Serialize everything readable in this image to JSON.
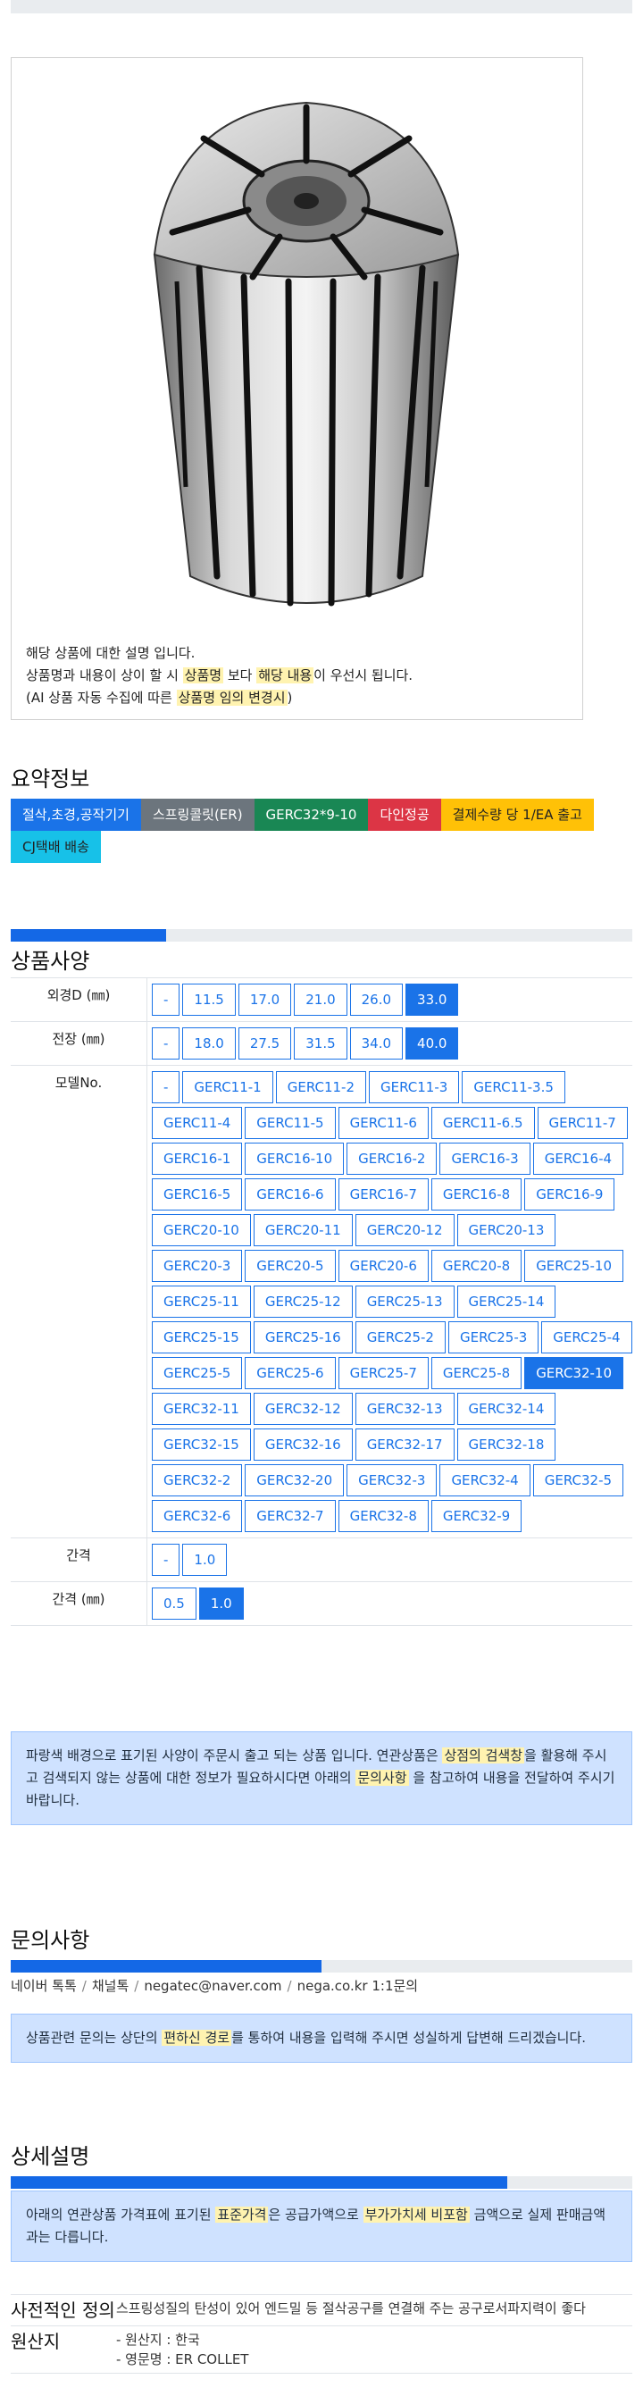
{
  "notice": {
    "line1": "해당 상품에 대한 설명 입니다.",
    "line2_pre": "상품명과 내용이 상이 할 시 ",
    "line2_hl1": "상품명",
    "line2_mid": " 보다 ",
    "line2_hl2": "해당 내용",
    "line2_post": "이 우선시 됩니다.",
    "line3_pre": "(AI 상품 자동 수집에 따른 ",
    "line3_hl": "상품명 임의 변경시",
    "line3_post": ")"
  },
  "summary": {
    "title": "요약정보",
    "badges": [
      "절삭,초경,공작기기",
      "스프링콜릿(ER)",
      "GERC32*9-10",
      "다인정공",
      "결제수량 당 1/EA 출고",
      "CJ택배 배송"
    ]
  },
  "spec": {
    "title": "상품사양",
    "rows": [
      {
        "label": "외경D (㎜)",
        "options": [
          "-",
          "11.5",
          "17.0",
          "21.0",
          "26.0",
          "33.0"
        ],
        "selected": "33.0"
      },
      {
        "label": "전장 (㎜)",
        "options": [
          "-",
          "18.0",
          "27.5",
          "31.5",
          "34.0",
          "40.0"
        ],
        "selected": "40.0"
      },
      {
        "label": "모델No.",
        "options": [
          "-",
          "GERC11-1",
          "GERC11-2",
          "GERC11-3",
          "GERC11-3.5",
          "GERC11-4",
          "GERC11-5",
          "GERC11-6",
          "GERC11-6.5",
          "GERC11-7",
          "GERC16-1",
          "GERC16-10",
          "GERC16-2",
          "GERC16-3",
          "GERC16-4",
          "GERC16-5",
          "GERC16-6",
          "GERC16-7",
          "GERC16-8",
          "GERC16-9",
          "GERC20-10",
          "GERC20-11",
          "GERC20-12",
          "GERC20-13",
          "GERC20-3",
          "GERC20-5",
          "GERC20-6",
          "GERC20-8",
          "GERC25-10",
          "GERC25-11",
          "GERC25-12",
          "GERC25-13",
          "GERC25-14",
          "GERC25-15",
          "GERC25-16",
          "GERC25-2",
          "GERC25-3",
          "GERC25-4",
          "GERC25-5",
          "GERC25-6",
          "GERC25-7",
          "GERC25-8",
          "GERC32-10",
          "GERC32-11",
          "GERC32-12",
          "GERC32-13",
          "GERC32-14",
          "GERC32-15",
          "GERC32-16",
          "GERC32-17",
          "GERC32-18",
          "GERC32-2",
          "GERC32-20",
          "GERC32-3",
          "GERC32-4",
          "GERC32-5",
          "GERC32-6",
          "GERC32-7",
          "GERC32-8",
          "GERC32-9"
        ],
        "selected": "GERC32-10"
      },
      {
        "label": "간격",
        "options": [
          "-",
          "1.0"
        ],
        "selected": ""
      },
      {
        "label": "간격 (㎜)",
        "options": [
          "0.5",
          "1.0"
        ],
        "selected": "1.0"
      }
    ],
    "info_pre": "파랑색 배경으로 표기된 사양이 주문시 출고 되는 상품 입니다. 연관상품은 ",
    "info_hl1": "상점의 검색창",
    "info_mid": "을 활용해 주시고 검색되지 않는 상품에 대한 정보가 필요하시다면 아래의 ",
    "info_hl2": "문의사항",
    "info_post": " 을 참고하여 내용을 전달하여 주시기 바랍니다."
  },
  "inquiry": {
    "title": "문의사항",
    "contacts": [
      "네이버 톡톡",
      "채널톡",
      "negatec@naver.com",
      "nega.co.kr 1:1문의"
    ],
    "info_pre": "상품관련 문의는 상단의 ",
    "info_hl": "편하신 경로",
    "info_post": "를 통하여 내용을 입력해 주시면 성실하게 답변해 드리겠습니다."
  },
  "detail": {
    "title": "상세설명",
    "info_pre": "아래의 연관상품 가격표에 표기된 ",
    "info_hl1": "표준가격",
    "info_mid": "은 공급가액으로 ",
    "info_hl2": "부가가치세 비포함",
    "info_post": " 금액으로 실제 판매금액과는 다릅니다.",
    "rows": [
      {
        "label": "사전적인 정의",
        "value": "스프링성질의 탄성이 있어 엔드밀 등 절삭공구를 연결해 주는 공구로서파지력이 좋다"
      },
      {
        "label": "원산지",
        "value": "- 원산지 : 한국",
        "value2": "- 영문명 : ER COLLET"
      }
    ]
  },
  "colors": {
    "accent": "#1a73e8",
    "progress": "#1468e6",
    "info_bg": "#cfe2ff",
    "highlight": "#fff3b0"
  }
}
